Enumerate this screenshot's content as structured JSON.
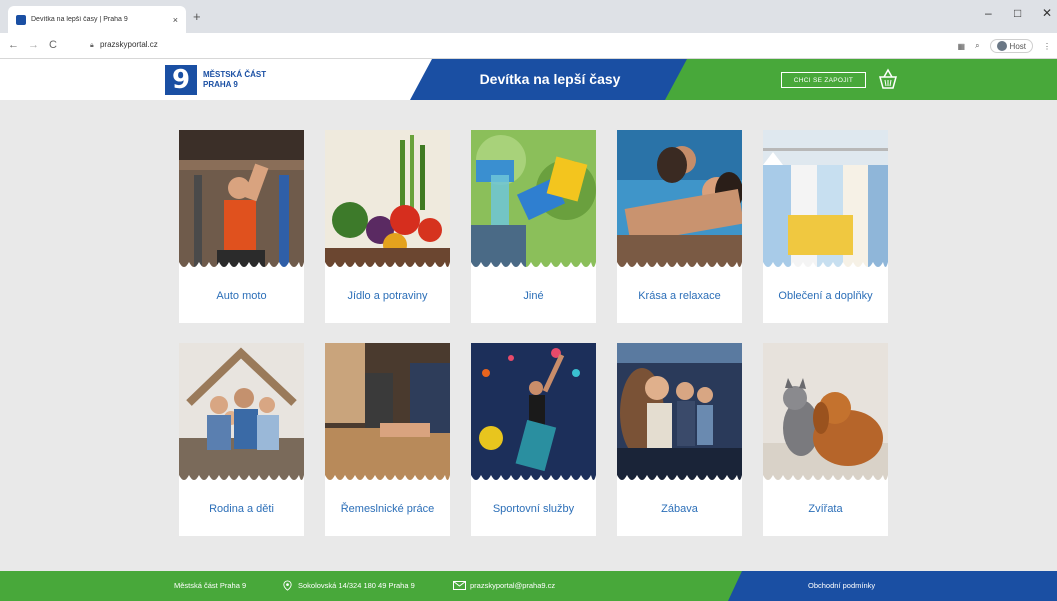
{
  "browser": {
    "tab_title": "Devítka na lepší časy | Praha 9",
    "tab_close": "×",
    "new_tab": "+",
    "url": "prazskyportal.cz",
    "host_label": "Host",
    "win_minimize": "–",
    "win_maximize": "□",
    "win_close": "✕"
  },
  "header": {
    "logo_digit": "9",
    "logo_line1": "MĚSTSKÁ ČÁST",
    "logo_line2": "PRAHA 9",
    "title": "Devítka na lepší časy",
    "join_label": "CHCI SE ZAPOJIT",
    "colors": {
      "blue": "#1a4fa3",
      "green": "#48a83a"
    }
  },
  "categories": [
    {
      "label": "Auto moto",
      "icon": "mechanic-photo"
    },
    {
      "label": "Jídlo a potraviny",
      "icon": "vegetables-photo"
    },
    {
      "label": "Jiné",
      "icon": "cleaning-photo"
    },
    {
      "label": "Krása a relaxace",
      "icon": "pool-relax-photo"
    },
    {
      "label": "Oblečení a doplňky",
      "icon": "clothes-rack-photo"
    },
    {
      "label": "Rodina a děti",
      "icon": "family-photo"
    },
    {
      "label": "Řemeslnické práce",
      "icon": "carpentry-photo"
    },
    {
      "label": "Sportovní služby",
      "icon": "climbing-photo"
    },
    {
      "label": "Zábava",
      "icon": "cinema-photo"
    },
    {
      "label": "Zvířata",
      "icon": "cat-dog-photo"
    }
  ],
  "footer": {
    "org": "Městská část Praha 9",
    "address": "Sokolovská 14/324 180 49 Praha 9",
    "email": "prazskyportal@praha9.cz",
    "terms": "Obchodní podmínky"
  }
}
